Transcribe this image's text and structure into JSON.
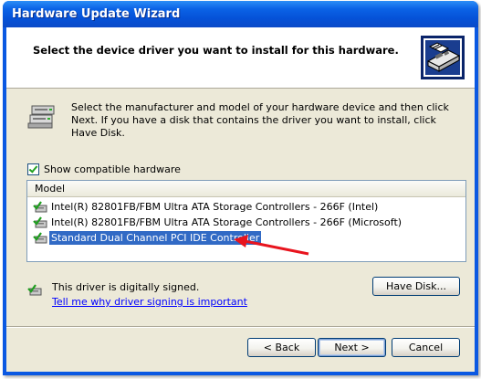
{
  "window": {
    "title": "Hardware Update Wizard"
  },
  "header": {
    "title": "Select the device driver you want to install for this hardware.",
    "icon": "hardware-card-icon"
  },
  "intro": {
    "icon": "device-drives-icon",
    "text": "Select the manufacturer and model of your hardware device and then click Next. If you have a disk that contains the driver you want to install, click Have Disk."
  },
  "compatible": {
    "label": "Show compatible hardware",
    "checked": true
  },
  "list": {
    "column_header": "Model",
    "items": [
      {
        "label": "Intel(R) 82801FB/FBM Ultra ATA Storage Controllers - 266F (Intel)",
        "icon": "signed-driver-icon",
        "selected": false
      },
      {
        "label": "Intel(R) 82801FB/FBM Ultra ATA Storage Controllers - 266F (Microsoft)",
        "icon": "signed-driver-icon",
        "selected": false
      },
      {
        "label": "Standard Dual Channel PCI IDE Controller",
        "icon": "signed-driver-icon",
        "selected": true
      }
    ]
  },
  "signing": {
    "status": "This driver is digitally signed.",
    "link": "Tell me why driver signing is important"
  },
  "buttons": {
    "have_disk": "Have Disk...",
    "back": "< Back",
    "next": "Next >",
    "cancel": "Cancel"
  },
  "annotation": {
    "arrow_color": "#e8141e"
  },
  "colors": {
    "title_bar": "#0a58e2",
    "selection": "#316ac5",
    "link": "#0000ff",
    "dialog_bg": "#ece9d8"
  }
}
